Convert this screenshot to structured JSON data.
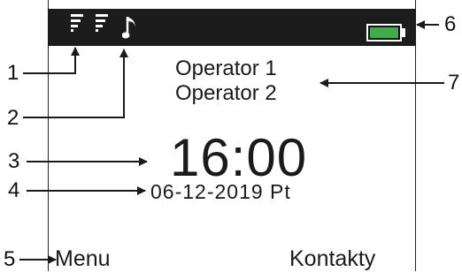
{
  "screen": {
    "operator_lines": [
      "Operator 1",
      "Operator 2"
    ],
    "time": "16:00",
    "date": "06-12-2019 Pt",
    "softkey_left": "Menu",
    "softkey_right": "Kontakty",
    "battery_level_fraction": 1.0,
    "battery_color": "#3fae49",
    "statusbar_icons": [
      "filter-icon",
      "filter-icon",
      "music-note-icon"
    ]
  },
  "callouts": [
    "1",
    "2",
    "3",
    "4",
    "5",
    "6",
    "7"
  ]
}
